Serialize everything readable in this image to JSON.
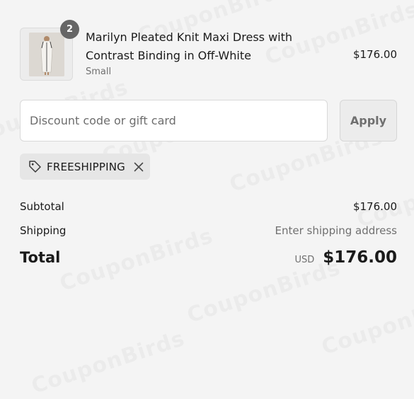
{
  "product": {
    "title": "Marilyn Pleated Knit Maxi Dress with Contrast Binding in Off-White",
    "variant": "Small",
    "price": "$176.00",
    "quantity": "2"
  },
  "discount": {
    "placeholder": "Discount code or gift card",
    "value": "",
    "apply_label": "Apply"
  },
  "applied_code": {
    "code": "FREESHIPPING"
  },
  "summary": {
    "subtotal_label": "Subtotal",
    "subtotal_value": "$176.00",
    "shipping_label": "Shipping",
    "shipping_value": "Enter shipping address",
    "total_label": "Total",
    "currency": "USD",
    "total_value": "$176.00"
  },
  "watermark": "CouponBirds",
  "icons": {
    "tag": "tag-icon",
    "remove": "close-icon"
  }
}
